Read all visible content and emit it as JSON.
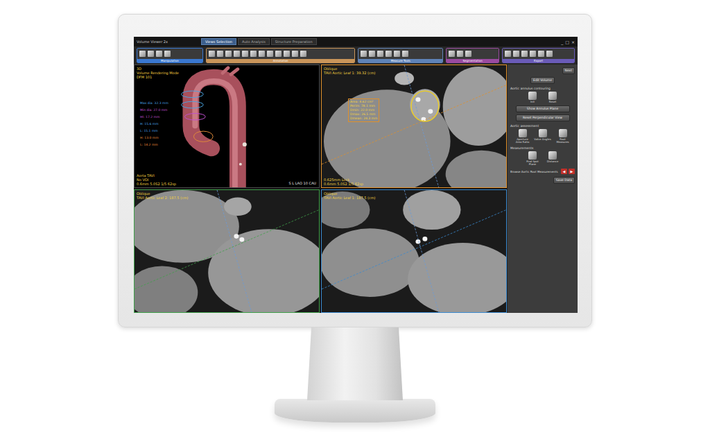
{
  "app": {
    "title": "Volume Viewer 2x",
    "controls": [
      "_",
      "□",
      "×"
    ]
  },
  "tabs": [
    {
      "label": "Views Selection",
      "selected": true
    },
    {
      "label": "Auto Analysis",
      "selected": false
    },
    {
      "label": "Structure Preparation",
      "selected": false
    }
  ],
  "toolbar": {
    "groups": [
      {
        "label": "Manipulation",
        "color": "#3a78d0"
      },
      {
        "label": "Annotation",
        "color": "#c9955a"
      },
      {
        "label": "Measure Tools",
        "color": "#5f83b8"
      },
      {
        "label": "Segmentation",
        "color": "#9a4aa0"
      },
      {
        "label": "Export",
        "color": "#6a5bb8"
      }
    ]
  },
  "viewports": [
    {
      "kind": "3d",
      "color": "#4a4a4a",
      "header": [
        "3D",
        "Volume Rendering Mode",
        "DFM 101"
      ],
      "footer": [
        "Aorta TAVI",
        "No VOI",
        "0.6mm 5.0S2 1/5 62sp"
      ],
      "corner": "S L LAO 10 CAU",
      "annotations": [
        {
          "text": "Max dia: 32.3 mm",
          "color": "#4aa3e0"
        },
        {
          "text": "Min dia: 27.0 mm",
          "color": "#c050d0"
        },
        {
          "text": "Ht: 17.2 mm",
          "color": "#c050d0"
        },
        {
          "text": "H: 15.6 mm",
          "color": "#4aa3e0"
        },
        {
          "text": "L: 15.1 mm",
          "color": "#4aa3e0"
        },
        {
          "text": "H: 13.0 mm",
          "color": "#e08a3a"
        },
        {
          "text": "L: 14.2 mm",
          "color": "#e08a3a"
        }
      ],
      "measures": []
    },
    {
      "kind": "ct",
      "color": "#e0902a",
      "header": [
        "Oblique",
        "TAVI Aortic Leaf 1: 39.32 (cm)"
      ],
      "footer": [
        "0.625mm Lock",
        "0.6mm 5.0S2 1/5 62sp"
      ],
      "corner": "",
      "annotations": [],
      "measures": [
        "Area: 4.62 cm²",
        "Perim: 78.1 mm",
        "Dmin: 22.0 mm",
        "Dmax: 26.5 mm",
        "Dmean: 24.3 mm"
      ]
    },
    {
      "kind": "ct",
      "color": "#3fa04a",
      "header": [
        "Oblique",
        "TAVI Aortic Leaf 2: 187.5 (cm)"
      ],
      "footer": [],
      "corner": "",
      "annotations": [],
      "measures": []
    },
    {
      "kind": "ct",
      "color": "#3a8ad0",
      "header": [
        "Oblique",
        "TAVI Aortic Leaf 1: 187.5 (cm)"
      ],
      "footer": [],
      "corner": "",
      "annotations": [],
      "measures": []
    }
  ],
  "panel": {
    "next": "Next",
    "edit": "Edit Volume",
    "sections": [
      {
        "title": "Aortic annulus contouring",
        "buttons": [
          {
            "label": "Init",
            "kind": "icon"
          },
          {
            "label": "Reset",
            "kind": "icon"
          },
          {
            "label": "Show Annulus Plane",
            "kind": "wide"
          },
          {
            "label": "Reset Perpendicular View",
            "kind": "wide"
          }
        ]
      },
      {
        "title": "Aortic assessment",
        "buttons": [
          {
            "label": "Aperture Area Ratio",
            "kind": "icon"
          },
          {
            "label": "Valve Angles",
            "kind": "icon"
          },
          {
            "label": "Root Measures",
            "kind": "icon"
          }
        ]
      },
      {
        "title": "Measurements",
        "buttons": [
          {
            "label": "Find Spot Plane",
            "kind": "icon"
          },
          {
            "label": "Distance",
            "kind": "icon"
          }
        ]
      }
    ],
    "browse": {
      "label": "Browse Aortic Root Measurements",
      "arrows": [
        "◀",
        "▶"
      ]
    },
    "save": "Save Data"
  }
}
